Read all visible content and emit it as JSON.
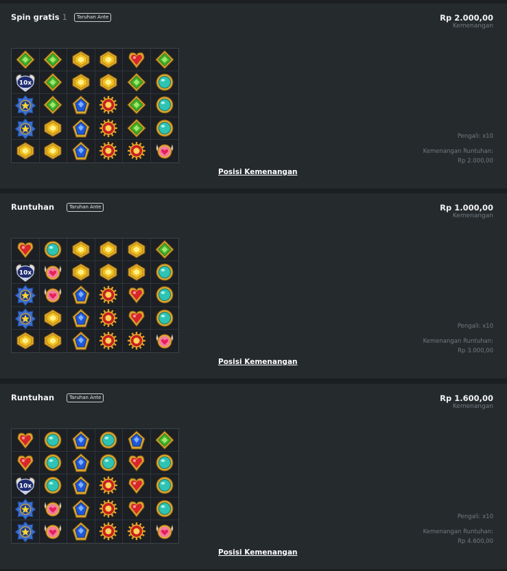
{
  "panels": [
    {
      "title": "Spin gratis",
      "count": "1",
      "badge": "Taruhan Ante",
      "amount": "Rp 2.000,00",
      "amount_label": "Kemenangan",
      "multiplier": "Pengali: x10",
      "cascade_label": "Kemenangan Runtuhan:",
      "cascade_value": "Rp 2.000,00",
      "link": "Posisi Kemenangan",
      "grid": [
        [
          "green",
          "green",
          "yellow",
          "yellow",
          "red",
          "green"
        ],
        [
          "multiplier",
          "green",
          "yellow",
          "yellow",
          "green",
          "teal"
        ],
        [
          "star",
          "green",
          "blue",
          "sun",
          "green",
          "teal"
        ],
        [
          "star",
          "yellow",
          "blue",
          "sun",
          "green",
          "teal"
        ],
        [
          "yellow",
          "yellow",
          "blue",
          "sun",
          "sun",
          "heart"
        ]
      ]
    },
    {
      "title": "Runtuhan",
      "count": "",
      "badge": "Taruhan Ante",
      "amount": "Rp 1.000,00",
      "amount_label": "Kemenangan",
      "multiplier": "Pengali: x10",
      "cascade_label": "Kemenangan Runtuhan:",
      "cascade_value": "Rp 3.000,00",
      "link": "Posisi Kemenangan",
      "grid": [
        [
          "red",
          "teal",
          "yellow",
          "yellow",
          "yellow",
          "green"
        ],
        [
          "multiplier",
          "heart",
          "yellow",
          "yellow",
          "yellow",
          "teal"
        ],
        [
          "star",
          "heart",
          "blue",
          "sun",
          "red",
          "teal"
        ],
        [
          "star",
          "yellow",
          "blue",
          "sun",
          "red",
          "teal"
        ],
        [
          "yellow",
          "yellow",
          "blue",
          "sun",
          "sun",
          "heart"
        ]
      ]
    },
    {
      "title": "Runtuhan",
      "count": "",
      "badge": "Taruhan Ante",
      "amount": "Rp 1.600,00",
      "amount_label": "Kemenangan",
      "multiplier": "Pengali: x10",
      "cascade_label": "Kemenangan Runtuhan:",
      "cascade_value": "Rp 4.600,00",
      "link": "Posisi Kemenangan",
      "grid": [
        [
          "red",
          "teal",
          "blue",
          "teal",
          "blue",
          "green"
        ],
        [
          "red",
          "teal",
          "blue",
          "teal",
          "red",
          "teal"
        ],
        [
          "multiplier",
          "teal",
          "blue",
          "sun",
          "red",
          "teal"
        ],
        [
          "star",
          "heart",
          "blue",
          "sun",
          "red",
          "teal"
        ],
        [
          "star",
          "heart",
          "blue",
          "sun",
          "sun",
          "heart"
        ]
      ]
    }
  ],
  "symbol_icons": {
    "green": "green-gem-icon",
    "yellow": "yellow-gem-icon",
    "red": "red-gem-icon",
    "teal": "teal-gem-icon",
    "blue": "blue-gem-icon",
    "sun": "sun-medallion-icon",
    "star": "star-medallion-icon",
    "heart": "winged-heart-icon",
    "multiplier": "multiplier-orb-icon"
  },
  "multiplier_text": "10x",
  "colors": {
    "background": "#1b1f22",
    "panel": "#252a2d",
    "muted_text": "#737a7f",
    "gold": "#e2b23a"
  }
}
